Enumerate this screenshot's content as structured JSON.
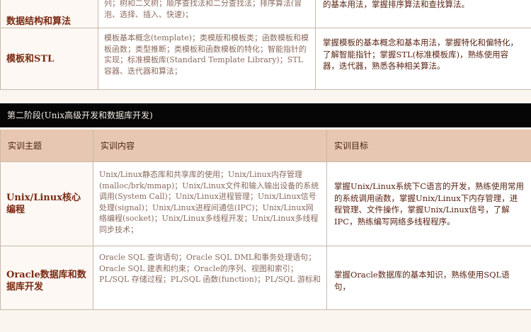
{
  "stage1": {
    "row_partial": {
      "topic": "数据结构和算法",
      "content": "列；树和二叉树；顺序查找法和二分查找法；排序算法(冒泡、选择、插入、快速)；",
      "goal": "的基本用法，掌握排序算法和查找算法。"
    },
    "row_template": {
      "topic": "模板和STL",
      "content": "模板基本概念(template)；类模版和模板类；函数模板和模板函数；类型推断；类模板和函数模板的特化；智能指针的实现；标准模板库(Standard Template Library)；STL容器、迭代器和算法；",
      "goal": "掌握模板的基本概念和基本用法，掌握特化和偏特化，了解智能指针；掌握STL(标准模板库)，熟练使用容器，迭代器，熟悉各种相关算法。"
    }
  },
  "stage2": {
    "title": "第二阶段(Unix高级开发和数据库开发)",
    "headers": {
      "topic": "实训主题",
      "content": "实训内容",
      "goal": "实训目标"
    },
    "rows": [
      {
        "topic": "Unix/Linux核心编程",
        "content": "Unix/Linux静态库和共享库的使用；Unix/Linux内存管理(malloc/brk/mmap)；Unix/Linux文件和输入输出设备的系统调用(System Call)；Unix/Linux进程管理；Unix/Linux信号处理(signal)；Unix/Linux进程间通信(IPC)；Unix/Linux网络编程(socket)；Unix/Linux多线程开发；Unix/Linux多线程同步技术；",
        "goal": "掌握Unix/Linux系统下C语言的开发，熟练使用常用的系统调用函数，掌握Unix/Linux下内存管理，进程管理、文件操作，掌握Unix/Linux信号，了解IPC，熟练编写网络多线程程序。"
      },
      {
        "topic": "Oracle数据库和数据库开发",
        "content": "Oracle SQL 查询语句；Oracle SQL DML和事务处理语句；Oracle SQL 建表和约束；Oracle的序列、视图和索引；PL/SQL 存储过程；PL/SQL 函数(function)；PL/SQL 游标和",
        "goal": "掌握Oracle数据库的基本知识，熟练使用SQL语句，"
      }
    ]
  }
}
